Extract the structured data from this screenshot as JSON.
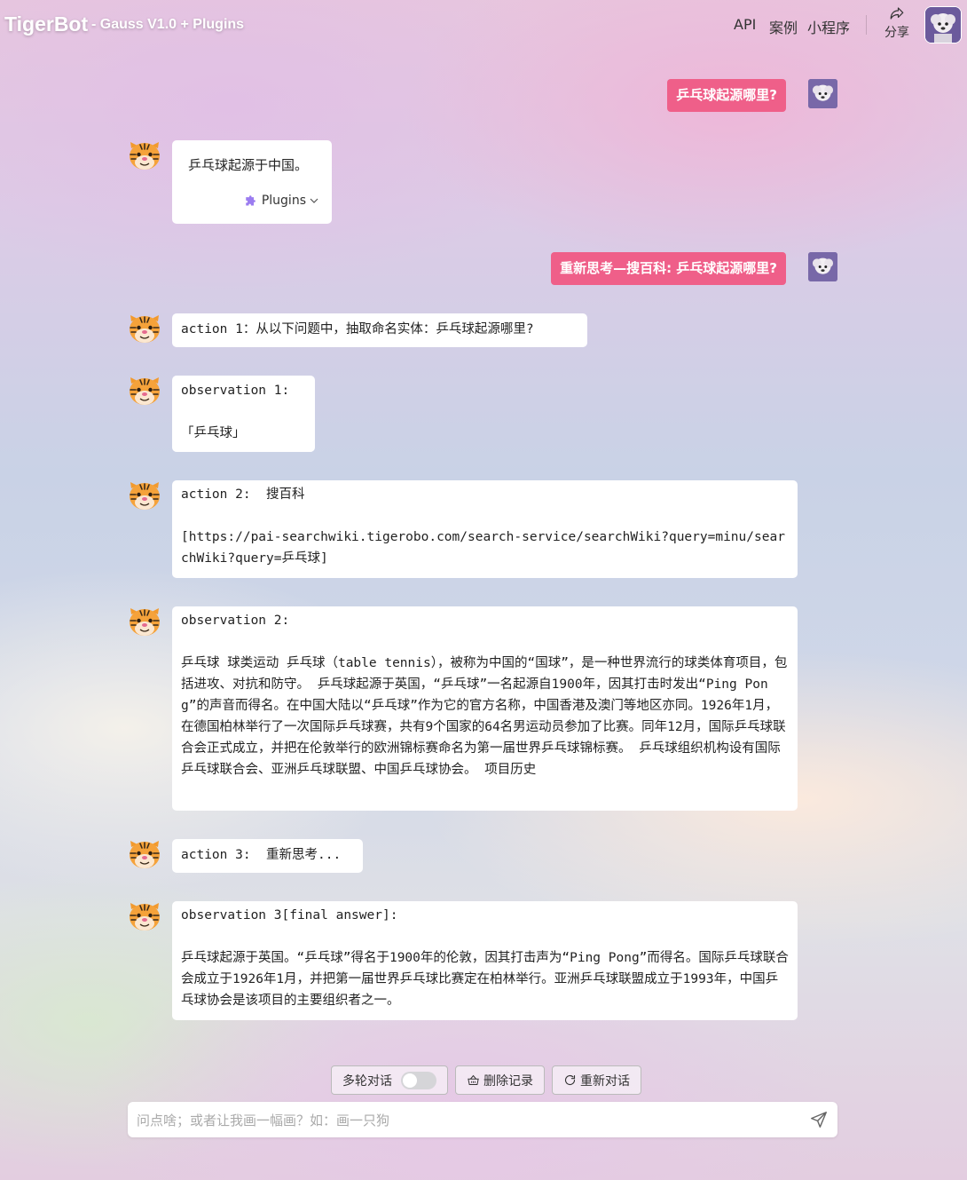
{
  "header": {
    "brand": "TigerBot",
    "subtitle": "- Gauss V1.0 + Plugins",
    "nav": [
      "API",
      "案例",
      "小程序"
    ],
    "share_label": "分享"
  },
  "messages": [
    {
      "role": "user",
      "text": "乒乓球起源哪里?"
    },
    {
      "role": "bot",
      "text": "乒乓球起源于中国。",
      "plugins_label": "Plugins"
    },
    {
      "role": "user",
      "text": "重新思考—搜百科: 乒乓球起源哪里?"
    },
    {
      "role": "bot",
      "text": "action 1：从以下问题中，抽取命名实体：乒乓球起源哪里?"
    },
    {
      "role": "bot",
      "text": "observation 1:\n\n「乒乓球」"
    },
    {
      "role": "bot",
      "text": "action 2:  搜百科\n\n[https://pai-searchwiki.tigerobo.com/search-service/searchWiki?query=minu/searchWiki?query=乒乓球]"
    },
    {
      "role": "bot",
      "text": "observation 2:\n\n乒乓球 球类运动 乒乓球（table tennis），被称为中国的“国球”，是一种世界流行的球类体育项目，包括进攻、对抗和防守。 乒乓球起源于英国，“乒乓球”一名起源自1900年，因其打击时发出“Ping Pong”的声音而得名。在中国大陆以“乒乓球”作为它的官方名称，中国香港及澳门等地区亦同。1926年1月，在德国柏林举行了一次国际乒乓球赛，共有9个国家的64名男运动员参加了比赛。同年12月，国际乒乓球联合会正式成立，并把在伦敦举行的欧洲锦标赛命名为第一届世界乒乓球锦标赛。 乒乓球组织机构设有国际乒乓球联合会、亚洲乒乓球联盟、中国乒乓球协会。 项目历史"
    },
    {
      "role": "bot",
      "text": "action 3:  重新思考..."
    },
    {
      "role": "bot",
      "text": "observation 3[final answer]:\n\n乒乓球起源于英国。“乒乓球”得名于1900年的伦敦，因其打击声为“Ping Pong”而得名。国际乒乓球联合会成立于1926年1月，并把第一届世界乒乓球比赛定在柏林举行。亚洲乒乓球联盟成立于1993年，中国乒乓球协会是该项目的主要组织者之一。"
    }
  ],
  "controls": {
    "multi_turn_label": "多轮对话",
    "multi_turn_enabled": false,
    "delete_label": "删除记录",
    "new_chat_label": "重新对话"
  },
  "input": {
    "placeholder": "问点啥；或者让我画一幅画？如：画一只狗",
    "value": ""
  },
  "colors": {
    "user_bubble": "#ef5f89",
    "bot_bubble": "#ffffff",
    "plugin_icon": "#9b7cf0"
  }
}
